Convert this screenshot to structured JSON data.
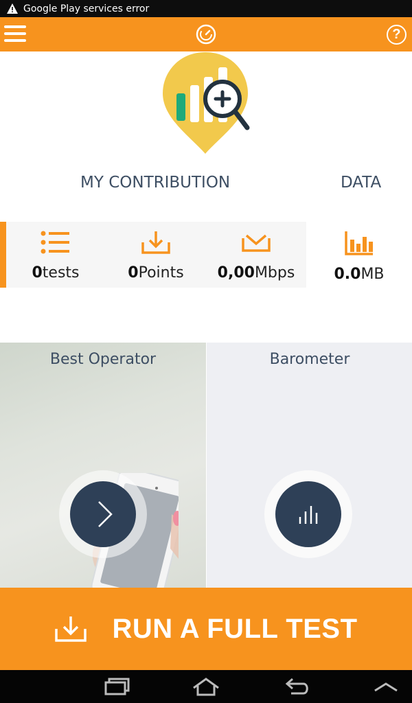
{
  "status_bar": {
    "notification": "Google Play services error"
  },
  "app_bar": {
    "menu_icon": "hamburger-menu-icon",
    "logo_icon": "speedometer-logo-icon",
    "help_label": "?"
  },
  "tabs": {
    "contribution": "MY CONTRIBUTION",
    "data": "DATA"
  },
  "stats": [
    {
      "icon": "list-icon",
      "value": "0",
      "unit": "tests"
    },
    {
      "icon": "download-tray-icon",
      "value": "0",
      "unit": "Points"
    },
    {
      "icon": "inbox-tray-icon",
      "value": "0,00",
      "unit": "Mbps"
    },
    {
      "icon": "bar-chart-icon",
      "value": "0.0",
      "unit": "MB"
    }
  ],
  "cards": {
    "best_operator": {
      "title": "Best Operator",
      "icon": "chevron-right-icon"
    },
    "barometer": {
      "title": "Barometer",
      "icon": "bars-icon"
    }
  },
  "run_button": {
    "label": "RUN A FULL TEST",
    "icon": "download-tray-icon"
  },
  "colors": {
    "accent": "#f7931e",
    "dark": "#2e4057",
    "text": "#3d4e63"
  }
}
